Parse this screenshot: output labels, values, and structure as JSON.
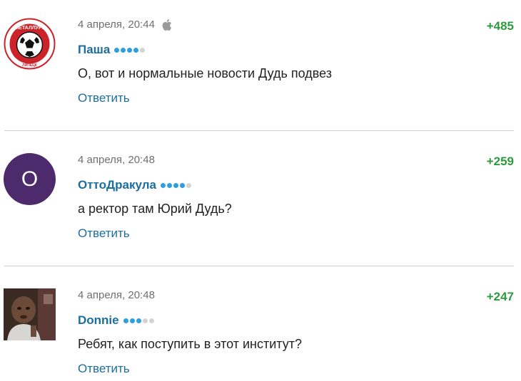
{
  "comments": [
    {
      "date": "4 апреля, 20:44",
      "device_icon": "apple-icon",
      "author": "Паша",
      "rating_dots": 4,
      "text": "О, вот и нормальные новости Дудь подвез",
      "reply_label": "Ответить",
      "score": "+485",
      "avatar": {
        "type": "logo",
        "text": "МЕТАЛЛУРГ",
        "subtext": "ЛИПЕЦК",
        "colors": {
          "ring": "#cc2229",
          "ball": "#111111"
        }
      }
    },
    {
      "date": "4 апреля, 20:48",
      "author": "ОттоДракула",
      "rating_dots": 4,
      "text": "а ректор там Юрий Дудь?",
      "reply_label": "Ответить",
      "score": "+259",
      "avatar": {
        "type": "letter",
        "letter": "O",
        "color": "#4c2a6c"
      }
    },
    {
      "date": "4 апреля, 20:48",
      "author": "Donnie",
      "rating_dots": 3,
      "text": "Ребят, как поступить в этот институт?",
      "reply_label": "Ответить",
      "score": "+247",
      "avatar": {
        "type": "photo"
      }
    }
  ],
  "colors": {
    "accent": "#1c6e9e",
    "score": "#2e9a3e",
    "dot_on": "#2d9fe0",
    "dot_off": "#d4d4d4"
  }
}
